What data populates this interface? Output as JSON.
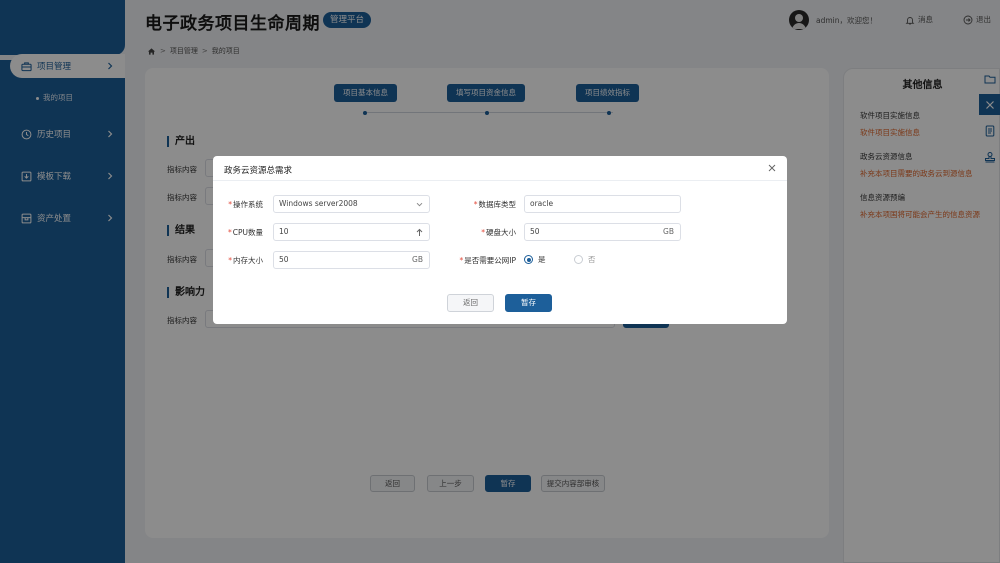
{
  "header": {
    "title": "电子政务项目生命周期",
    "badge": "管理平台",
    "welcome": "admin，欢迎您！",
    "messages_label": "消息",
    "logout_label": "退出"
  },
  "breadcrumb": [
    "项目管理",
    "我的项目"
  ],
  "sidebar": {
    "items": [
      {
        "label": "项目管理",
        "icon": "briefcase-icon",
        "active": true
      },
      {
        "label": "历史项目",
        "icon": "clock-icon"
      },
      {
        "label": "模板下载",
        "icon": "download-icon"
      },
      {
        "label": "资产处置",
        "icon": "box-icon"
      }
    ],
    "sub_item": "我的项目"
  },
  "steps": [
    "项目基本信息",
    "填写项目资金信息",
    "项目绩效指标"
  ],
  "sections": [
    {
      "title": "产出",
      "rows": [
        "指标内容",
        "指标内容"
      ]
    },
    {
      "title": "结果",
      "rows": [
        "指标内容"
      ]
    },
    {
      "title": "影响力",
      "rows": [
        "指标内容"
      ]
    }
  ],
  "bottom_buttons": {
    "back": "返回",
    "prev": "上一步",
    "save": "暂存",
    "submit": "提交内容部审核"
  },
  "info_panel": {
    "title": "其他信息",
    "groups": [
      {
        "heading": "软件项目实施信息",
        "link": "软件项目实施信息"
      },
      {
        "heading": "政务云资源信息",
        "link": "补充本项目需要的政务云到源信息"
      },
      {
        "heading": "信息资源预编",
        "link": "补充本项国将可能会产生的信息资源"
      }
    ]
  },
  "modal": {
    "title": "政务云资源总需求",
    "os_label": "操作系统",
    "os_value": "Windows server2008",
    "db_label": "数据库类型",
    "db_value": "oracle",
    "cpu_label": "CPU数量",
    "cpu_value": "10",
    "disk_label": "硬盘大小",
    "disk_value": "50",
    "disk_unit": "GB",
    "mem_label": "内存大小",
    "mem_value": "50",
    "mem_unit": "GB",
    "ip_label": "是否需要公网IP",
    "ip_yes": "是",
    "ip_no": "否",
    "back_label": "返回",
    "save_label": "暂存"
  },
  "colors": {
    "primary": "#1d5f9a",
    "link": "#e0662b",
    "required": "#e24a3b"
  }
}
